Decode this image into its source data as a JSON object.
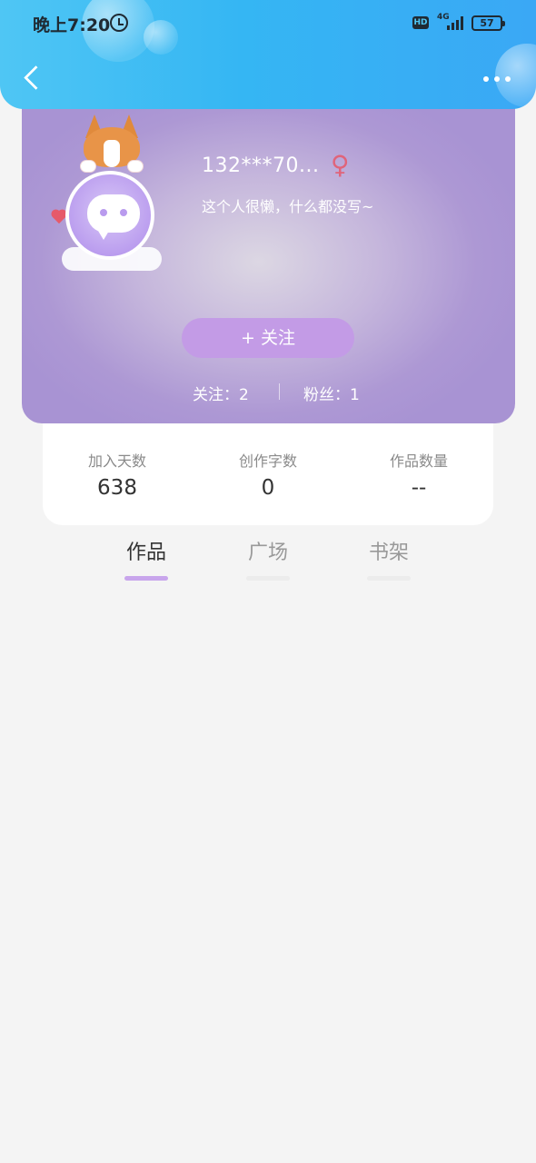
{
  "status_bar": {
    "time": "晚上7:20",
    "hd": "HD",
    "network": "4G",
    "battery": "57"
  },
  "nav": {
    "back_icon": "chevron-left-icon",
    "more_icon": "more-horizontal-icon"
  },
  "profile": {
    "username": "132***70...",
    "gender_symbol": "♀",
    "bio": "这个人很懒，什么都没写~",
    "follow_button": "+   关注",
    "following_label": "关注：2",
    "fans_label": "粉丝：1",
    "avatar_icon": "chat-bubble-avatar-icon"
  },
  "stats": [
    {
      "label": "加入天数",
      "value": "638"
    },
    {
      "label": "创作字数",
      "value": "0"
    },
    {
      "label": "作品数量",
      "value": "--"
    }
  ],
  "tabs": [
    {
      "label": "作品",
      "active": true
    },
    {
      "label": "广场",
      "active": false
    },
    {
      "label": "书架",
      "active": false
    }
  ],
  "colors": {
    "header_blue": "#35b6f3",
    "card_purple": "#ad98d4",
    "follow_button": "#c39be6",
    "gender_pink": "#e0647a",
    "tab_indicator_active": "#c8a5ec",
    "page_background": "#f4f4f4"
  }
}
